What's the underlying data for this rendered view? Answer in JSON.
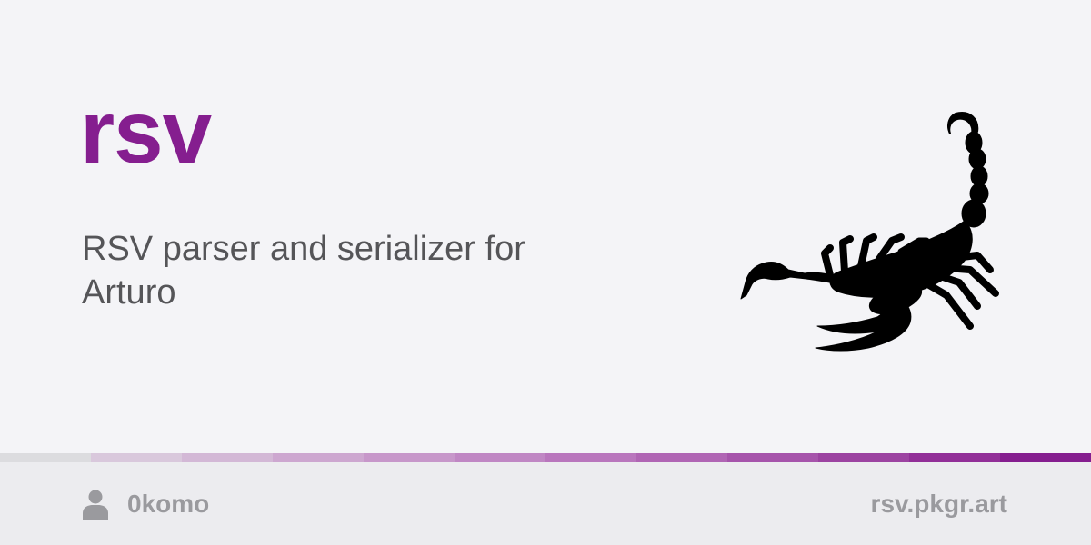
{
  "package": {
    "name": "rsv",
    "description": "RSV parser and serializer for Arturo",
    "logo_icon": "scorpion-icon"
  },
  "footer": {
    "author_icon": "user-icon",
    "author": "0komo",
    "domain": "rsv.pkgr.art"
  },
  "colors": {
    "accent": "#851e8f",
    "background": "#f4f4f7",
    "footer_background": "#ececef",
    "muted_text": "#9a9a9e",
    "description_text": "#555558",
    "progress_segments": [
      "#dcdcdf",
      "#d9c8dc",
      "#d3b8d6",
      "#cda7d0",
      "#c797ca",
      "#c087c4",
      "#b976bd",
      "#b065b4",
      "#a654ab",
      "#9c43a1",
      "#922f98",
      "#851e8f"
    ]
  }
}
